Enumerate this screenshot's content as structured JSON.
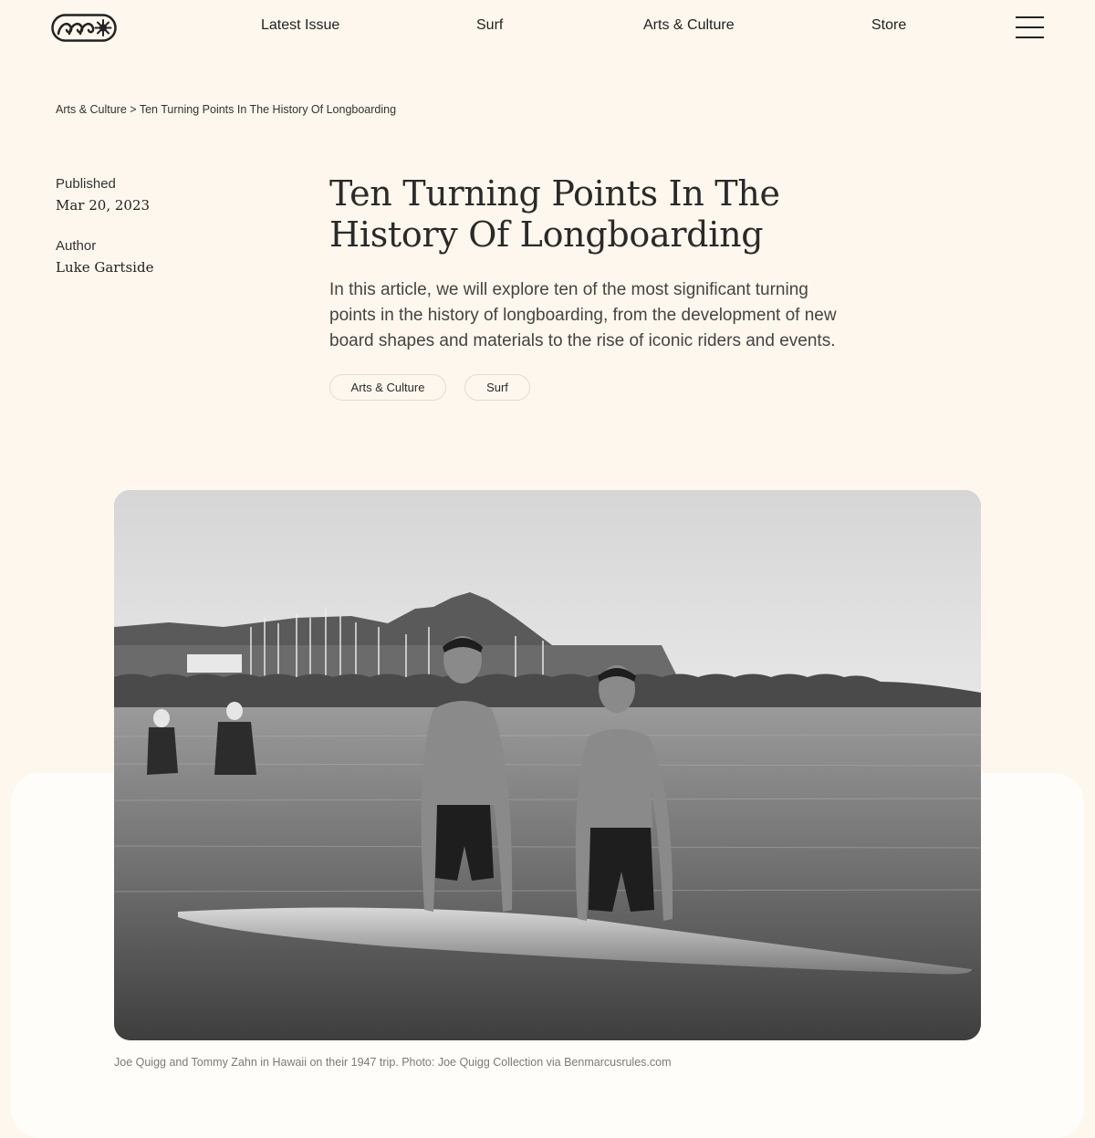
{
  "header": {
    "logo_icon": "wave-sun-logo-icon",
    "nav": [
      {
        "label": "Latest Issue"
      },
      {
        "label": "Surf"
      },
      {
        "label": "Arts & Culture"
      },
      {
        "label": "Store"
      }
    ],
    "menu_icon": "hamburger-menu-icon"
  },
  "breadcrumb": {
    "parent": "Arts & Culture",
    "separator": ">",
    "current": "Ten Turning Points In The History Of Longboarding"
  },
  "meta": {
    "published_label": "Published",
    "published_value": "Mar 20, 2023",
    "author_label": "Author",
    "author_value": "Luke Gartside"
  },
  "article": {
    "title": "Ten Turning Points In The History Of Longboarding",
    "lead": "In this article, we will explore ten of the most significant turning points in the history of longboarding, from the development of new board shapes and materials to the rise of iconic riders and events.",
    "tags": [
      {
        "label": "Arts & Culture"
      },
      {
        "label": "Surf"
      }
    ]
  },
  "hero": {
    "caption": "Joe Quigg and Tommy Zahn in Hawaii on their 1947 trip. Photo: Joe Quigg Collection via Benmarcusrules.com"
  },
  "colors": {
    "background": "#fdf7ed",
    "panel": "#fffdf9",
    "text": "#2b2b2b",
    "tag_border": "#e3dccf"
  }
}
